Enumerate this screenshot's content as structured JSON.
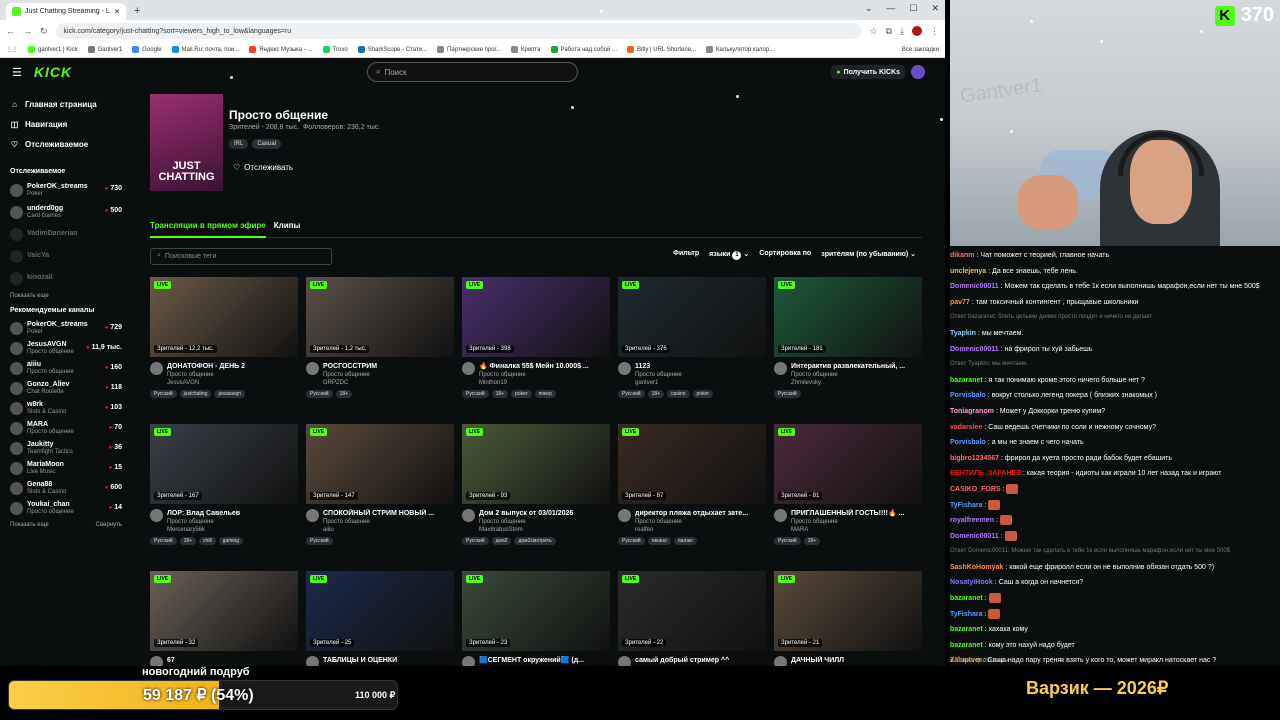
{
  "browser": {
    "tab_title": "Just Chatting Streaming - Live",
    "url": "kick.com/category/just-chatting?sort=viewers_high_to_low&languages=ru",
    "bookmarks": [
      "gantver1 | Kick",
      "Gantver1",
      "Google",
      "Mail.Ru: почта, пои...",
      "Яндекс Музыка - ...",
      "Trovo",
      "SharkScope - Стати...",
      "Партнерские прог...",
      "Криптa",
      "Работа над собой ...",
      "Bitly | URL Shortene...",
      "Калькулятор калор..."
    ],
    "all_bookmarks": "Все закладки"
  },
  "kick": {
    "logo": "KICK",
    "search_placeholder": "Поиск",
    "get_kicks": "Получить KICKs"
  },
  "sidebar": {
    "nav": [
      {
        "label": "Главная страница",
        "icon": "home-icon"
      },
      {
        "label": "Навигация",
        "icon": "compass-icon"
      },
      {
        "label": "Отслеживаемое",
        "icon": "heart-icon"
      }
    ],
    "following_title": "Отслеживаемое",
    "following": [
      {
        "name": "PokerOK_streams",
        "game": "Poker",
        "viewers": "730",
        "online": true
      },
      {
        "name": "underd0gg",
        "game": "Card Games",
        "viewers": "500",
        "online": true
      },
      {
        "name": "VadimDanerian",
        "game": "",
        "viewers": "",
        "online": false
      },
      {
        "name": "VaicYa",
        "game": "",
        "viewers": "",
        "online": false
      },
      {
        "name": "kinozall",
        "game": "",
        "viewers": "",
        "online": false
      }
    ],
    "show_more_1": "Показать еще",
    "recommended_title": "Рекомендуемые каналы",
    "recommended": [
      {
        "name": "PokerOK_streams",
        "game": "Poker",
        "viewers": "729"
      },
      {
        "name": "JesusAVGN",
        "game": "Просто общение",
        "viewers": "11,9 тыс."
      },
      {
        "name": "aiiiu",
        "game": "Просто общение",
        "viewers": "160"
      },
      {
        "name": "Gonzo_Aliev",
        "game": "Chat Roulette",
        "viewers": "118"
      },
      {
        "name": "w8rk",
        "game": "Slots & Casino",
        "viewers": "103"
      },
      {
        "name": "MARA",
        "game": "Просто общение",
        "viewers": "70"
      },
      {
        "name": "Jaukitty",
        "game": "Teamfight Tactics",
        "viewers": "36"
      },
      {
        "name": "MariaMoon",
        "game": "Live Music",
        "viewers": "15"
      },
      {
        "name": "Gena88",
        "game": "Slots & Casino",
        "viewers": "600"
      },
      {
        "name": "Youkai_chan",
        "game": "Просто общение",
        "viewers": "14"
      }
    ],
    "show_more_2": "Показать еще",
    "collapse": "Свернуть"
  },
  "category": {
    "image_text": "JUST CHATTING",
    "title": "Просто общение",
    "viewers": "Зрителей - 208,8 тыс.",
    "followers": "Фолловеров: 236,2 тыс.",
    "tags": [
      "IRL",
      "Casual"
    ],
    "follow_label": "Отслеживать",
    "tab_live": "Трансляции в прямом эфире",
    "tab_clips": "Клипы",
    "tag_search_placeholder": "Поисковые теги",
    "filter_label": "Фильтр",
    "languages_label": "языки",
    "languages_count": "1",
    "sort_label": "Сортировка по",
    "sort_value": "зрителям (по убыванию)"
  },
  "streams": [
    {
      "viewers": "Зрителей - 12,2 тыс.",
      "title": "ДОНАТОФОН - ДЕНЬ 2",
      "category": "Просто общение",
      "streamer": "JesusAVGN",
      "tags": [
        "Русский",
        "justchating",
        "jesusavgn"
      ],
      "color": "#6b5a48"
    },
    {
      "viewers": "Зрителей - 1,2 тыс.",
      "title": "РОСГОССТРИМ",
      "category": "Просто общение",
      "streamer": "GRPZDC",
      "tags": [
        "Русский",
        "18+"
      ],
      "color": "#5a5048"
    },
    {
      "viewers": "Зрителей - 398",
      "title": "🔥 Финалка 55$ Мейн 10.000$ ...",
      "category": "Просто общение",
      "streamer": "Minthon19",
      "tags": [
        "Русский",
        "18+",
        "poker",
        "покер"
      ],
      "color": "#4a2f6b"
    },
    {
      "viewers": "Зрителей - 376",
      "title": "1123",
      "category": "Просто общение",
      "streamer": "gantver1",
      "tags": [
        "Русский",
        "18+",
        "casino",
        "poker"
      ],
      "color": "#1e2a30"
    },
    {
      "viewers": "Зрителей - 181",
      "title": "Интерактив развлекательный, ...",
      "category": "Просто общение",
      "streamer": "Zhmilevsky",
      "tags": [
        "Русский"
      ],
      "color": "#1f5a3a"
    },
    {
      "viewers": "Зрителей - 167",
      "title": "ЛОР: Влад Савельев",
      "category": "Просто общение",
      "streamer": "Mercenary56k",
      "tags": [
        "Русский",
        "18+",
        "chill",
        "gaming"
      ],
      "color": "#3a4048"
    },
    {
      "viewers": "Зрителей - 147",
      "title": "СПОКОЙНЫЙ СТРИМ НОВЫЙ ...",
      "category": "Просто общение",
      "streamer": "aiiiu",
      "tags": [
        "Русский"
      ],
      "color": "#5b4a3a"
    },
    {
      "viewers": "Зрителей - 93",
      "title": "Дом 2 выпуск от 03/01/2026",
      "category": "Просто общение",
      "streamer": "Max8rabusStrim",
      "tags": [
        "Русский",
        "дом2",
        "дом2смотреть"
      ],
      "color": "#4a5a3a"
    },
    {
      "viewers": "Зрителей - 87",
      "title": "директор пляжа отдыхает зате...",
      "category": "Просто общение",
      "streamer": "realfeo",
      "tags": [
        "Русский",
        "гикано",
        "палаю"
      ],
      "color": "#3a2a22"
    },
    {
      "viewers": "Зрителей - 81",
      "title": "ПРИГЛАШЕННЫЙ ГОСТЬ!!!!🔥 ...",
      "category": "Просто общение",
      "streamer": "MARA",
      "tags": [
        "Русский",
        "18+"
      ],
      "color": "#4a2a3a"
    },
    {
      "viewers": "Зрителей - 32",
      "title": "67",
      "category": "",
      "streamer": "",
      "tags": [],
      "color": "#6a6058"
    },
    {
      "viewers": "Зрителей - 25",
      "title": "ТАБЛИЦЫ И ОЦЕНКИ",
      "category": "",
      "streamer": "",
      "tags": [],
      "color": "#1a2a48"
    },
    {
      "viewers": "Зрителей - 23",
      "title": "🟦СЕГМЕНТ окружений🟦 (д...",
      "category": "",
      "streamer": "",
      "tags": [],
      "color": "#3a4a3a"
    },
    {
      "viewers": "Зрителей - 22",
      "title": "самый добрый стример ^^",
      "category": "",
      "streamer": "",
      "tags": [],
      "color": "#2a2a2a"
    },
    {
      "viewers": "Зрителей - 21",
      "title": "ДАЧНЫЙ ЧИЛЛ",
      "category": "",
      "streamer": "",
      "tags": [],
      "color": "#5a4a3a"
    }
  ],
  "live_label": "LIVE",
  "webcam": {
    "kicks_count": "370",
    "wall_text": "Gantver1"
  },
  "chat": [
    {
      "user": "dikanm",
      "text": "Чат поможет с теорией, главное начать",
      "color": "#ff6b6b"
    },
    {
      "user": "unclejenya",
      "text": "Да все знаешь, тебе лень.",
      "color": "#f0c14b"
    },
    {
      "user": "Domenic00011",
      "text": "Можем так сделать в тебе 1к если выполнишь марафон,если нет ты мне 500$",
      "color": "#b478ff"
    },
    {
      "user": "pav77",
      "text": "там токсичный контингент , прыщавые школьники",
      "color": "#ff8c42"
    },
    {
      "reply": "Ответ bazaranet: блять целыми днями просто пиздит и ничего не делает"
    },
    {
      "user": "Tyapkin",
      "text": "мы мечтаем.",
      "color": "#7cd3ff"
    },
    {
      "user": "Domenic00011",
      "text": "на фрирол ты хуй забьешь",
      "color": "#b478ff"
    },
    {
      "reply": "Ответ Tyapkin: мы мечтаем."
    },
    {
      "user": "bazaranet",
      "text": "я так понимаю кроме этого ничего больше нет ?",
      "color": "#53fc18"
    },
    {
      "user": "Porvisbalo",
      "text": "вокруг столько легенд покера ( близких знакомых )",
      "color": "#5a9cff"
    },
    {
      "user": "Toniagranom",
      "text": "Может у Доккорки треню купим?",
      "color": "#ff9ad5"
    },
    {
      "user": "vadarsiee",
      "text": "Саш ведешь счетчики по соли и нежному сочному?",
      "color": "#ff4d4d"
    },
    {
      "user": "Porvisbalo",
      "text": "а мы не знаем с чего начать",
      "color": "#5a9cff"
    },
    {
      "user": "bigbro1234567",
      "text": "фрирол да хуета просто ради бабок будет ебашить",
      "color": "#ff6b6b"
    },
    {
      "user": "ВЕНТИЛЬ_ЗАРАНЕЕ",
      "text": "какая теория - идиоты как играли 10 лет назад так и играют",
      "color": "#e91916"
    },
    {
      "user": "CASIKO_FORS",
      "text": "",
      "emote": true,
      "color": "#ff6b6b"
    },
    {
      "user": "TyFishara",
      "text": "",
      "emote": true,
      "color": "#5a9cff"
    },
    {
      "user": "royalfreemen",
      "text": "",
      "emote": true,
      "color": "#b478ff"
    },
    {
      "user": "Domenic00011",
      "text": "",
      "emote": true,
      "color": "#b478ff"
    },
    {
      "reply": "Ответ Domenic00011: Можем так сделать в тебе 1к если выполнишь марафон,если нет ты мне 500$"
    },
    {
      "user": "SashKoHomyak",
      "text": "какой еще фриролл если он не выполнив обязан отдать 500 ?)",
      "color": "#ff8c42"
    },
    {
      "user": "NosatyiHook",
      "text": "Саш а когда он начнется?",
      "color": "#7c7cff"
    },
    {
      "user": "bazaranet",
      "text": "",
      "emote": true,
      "color": "#53fc18"
    },
    {
      "user": "TyFishara",
      "text": "",
      "emote": true,
      "color": "#5a9cff"
    },
    {
      "user": "bazaranet",
      "text": "хахаха кому",
      "color": "#53fc18"
    },
    {
      "user": "bazaranet",
      "text": "кому это нахуй надо будет",
      "color": "#53fc18"
    },
    {
      "user": "Zaluptver",
      "text": "Саша надо пару треняк взять у кого то, может миракл натоскает нас ?",
      "color": "#f0a030"
    }
  ],
  "chat_footer": "Только фолловеры",
  "goal": {
    "title": "новогодний подруб",
    "current": "59 187 ₽ (54%)",
    "percent": 54,
    "target": "110 000 ₽"
  },
  "overlay_text": "Варзик — 2026₽"
}
